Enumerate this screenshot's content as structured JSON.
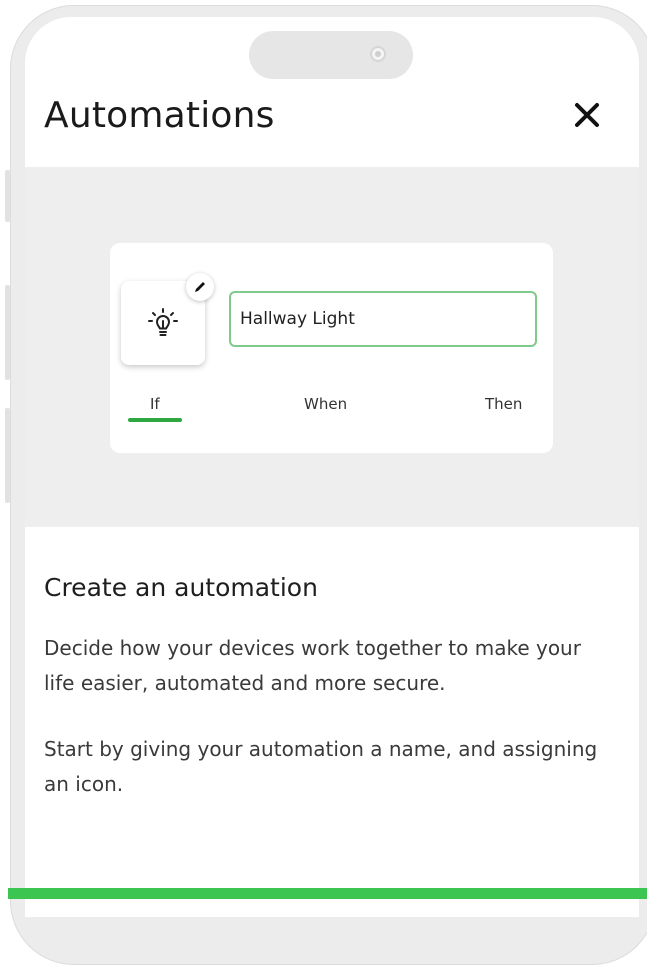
{
  "header": {
    "title": "Automations"
  },
  "preview": {
    "automation_name": "Hallway Light",
    "icon": "lightbulb-icon",
    "steps": [
      {
        "label": "If",
        "active": true
      },
      {
        "label": "When",
        "active": false
      },
      {
        "label": "Then",
        "active": false
      }
    ]
  },
  "content": {
    "heading": "Create an automation",
    "paragraph_1": "Decide how your devices work together to make your life easier, automated and more secure.",
    "paragraph_2": "Start by giving your automation a name, and assigning an icon."
  },
  "colors": {
    "accent": "#3cc651",
    "input_border": "#7fc98a",
    "preview_background": "#eeeeee"
  }
}
